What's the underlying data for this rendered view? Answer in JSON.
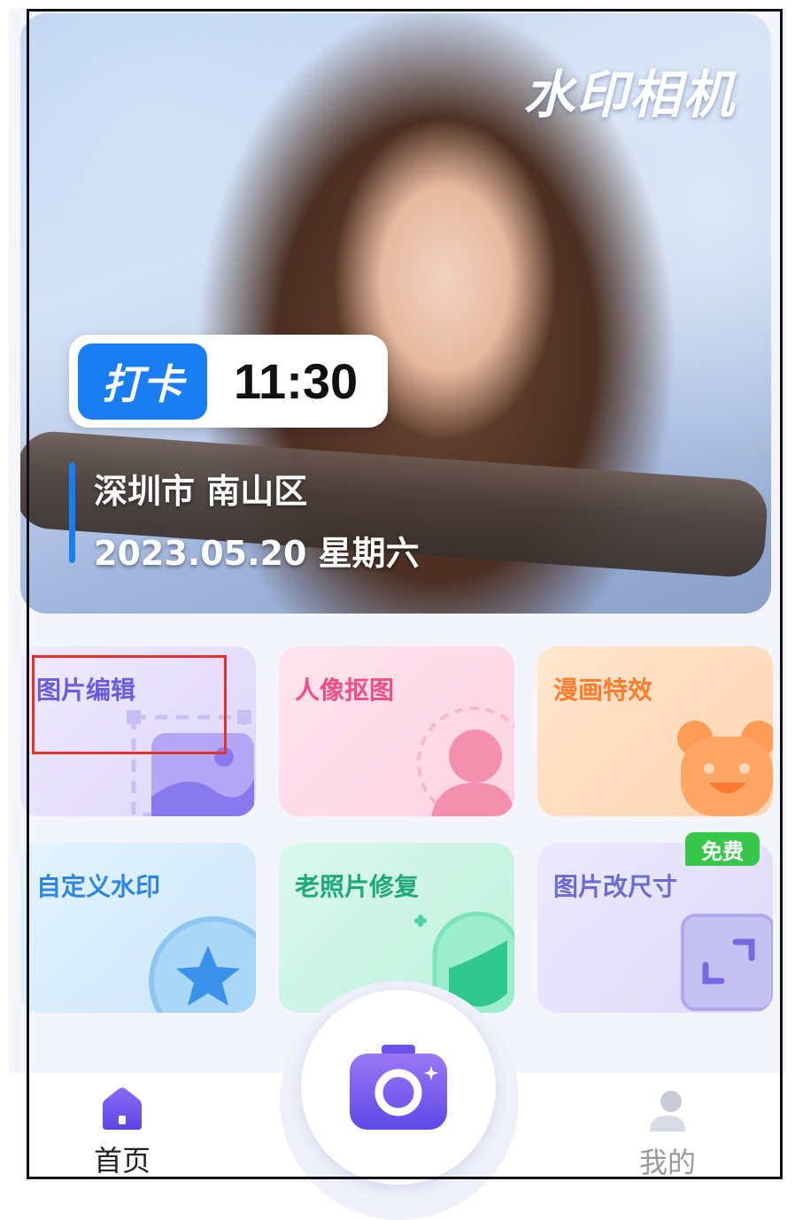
{
  "hero": {
    "title": "水印相机",
    "clock_tag": "打卡",
    "clock_time": "11:30",
    "location": "深圳市  南山区",
    "date": "2023.05.20   星期六"
  },
  "cards": [
    {
      "label": "图片编辑"
    },
    {
      "label": "人像抠图"
    },
    {
      "label": "漫画特效"
    },
    {
      "label": "自定义水印"
    },
    {
      "label": "老照片修复"
    },
    {
      "label": "图片改尺寸"
    }
  ],
  "free_badge": "免费",
  "nav": {
    "home_label": "首页",
    "mine_label": "我的"
  },
  "colors": {
    "accent_blue": "#1a7ef2",
    "highlight_red": "#e8302a",
    "free_green": "#37c84b",
    "camera_purple": "#7b5cf0"
  },
  "icons": {
    "home": "home-icon",
    "camera": "camera-icon",
    "profile": "user-icon"
  }
}
